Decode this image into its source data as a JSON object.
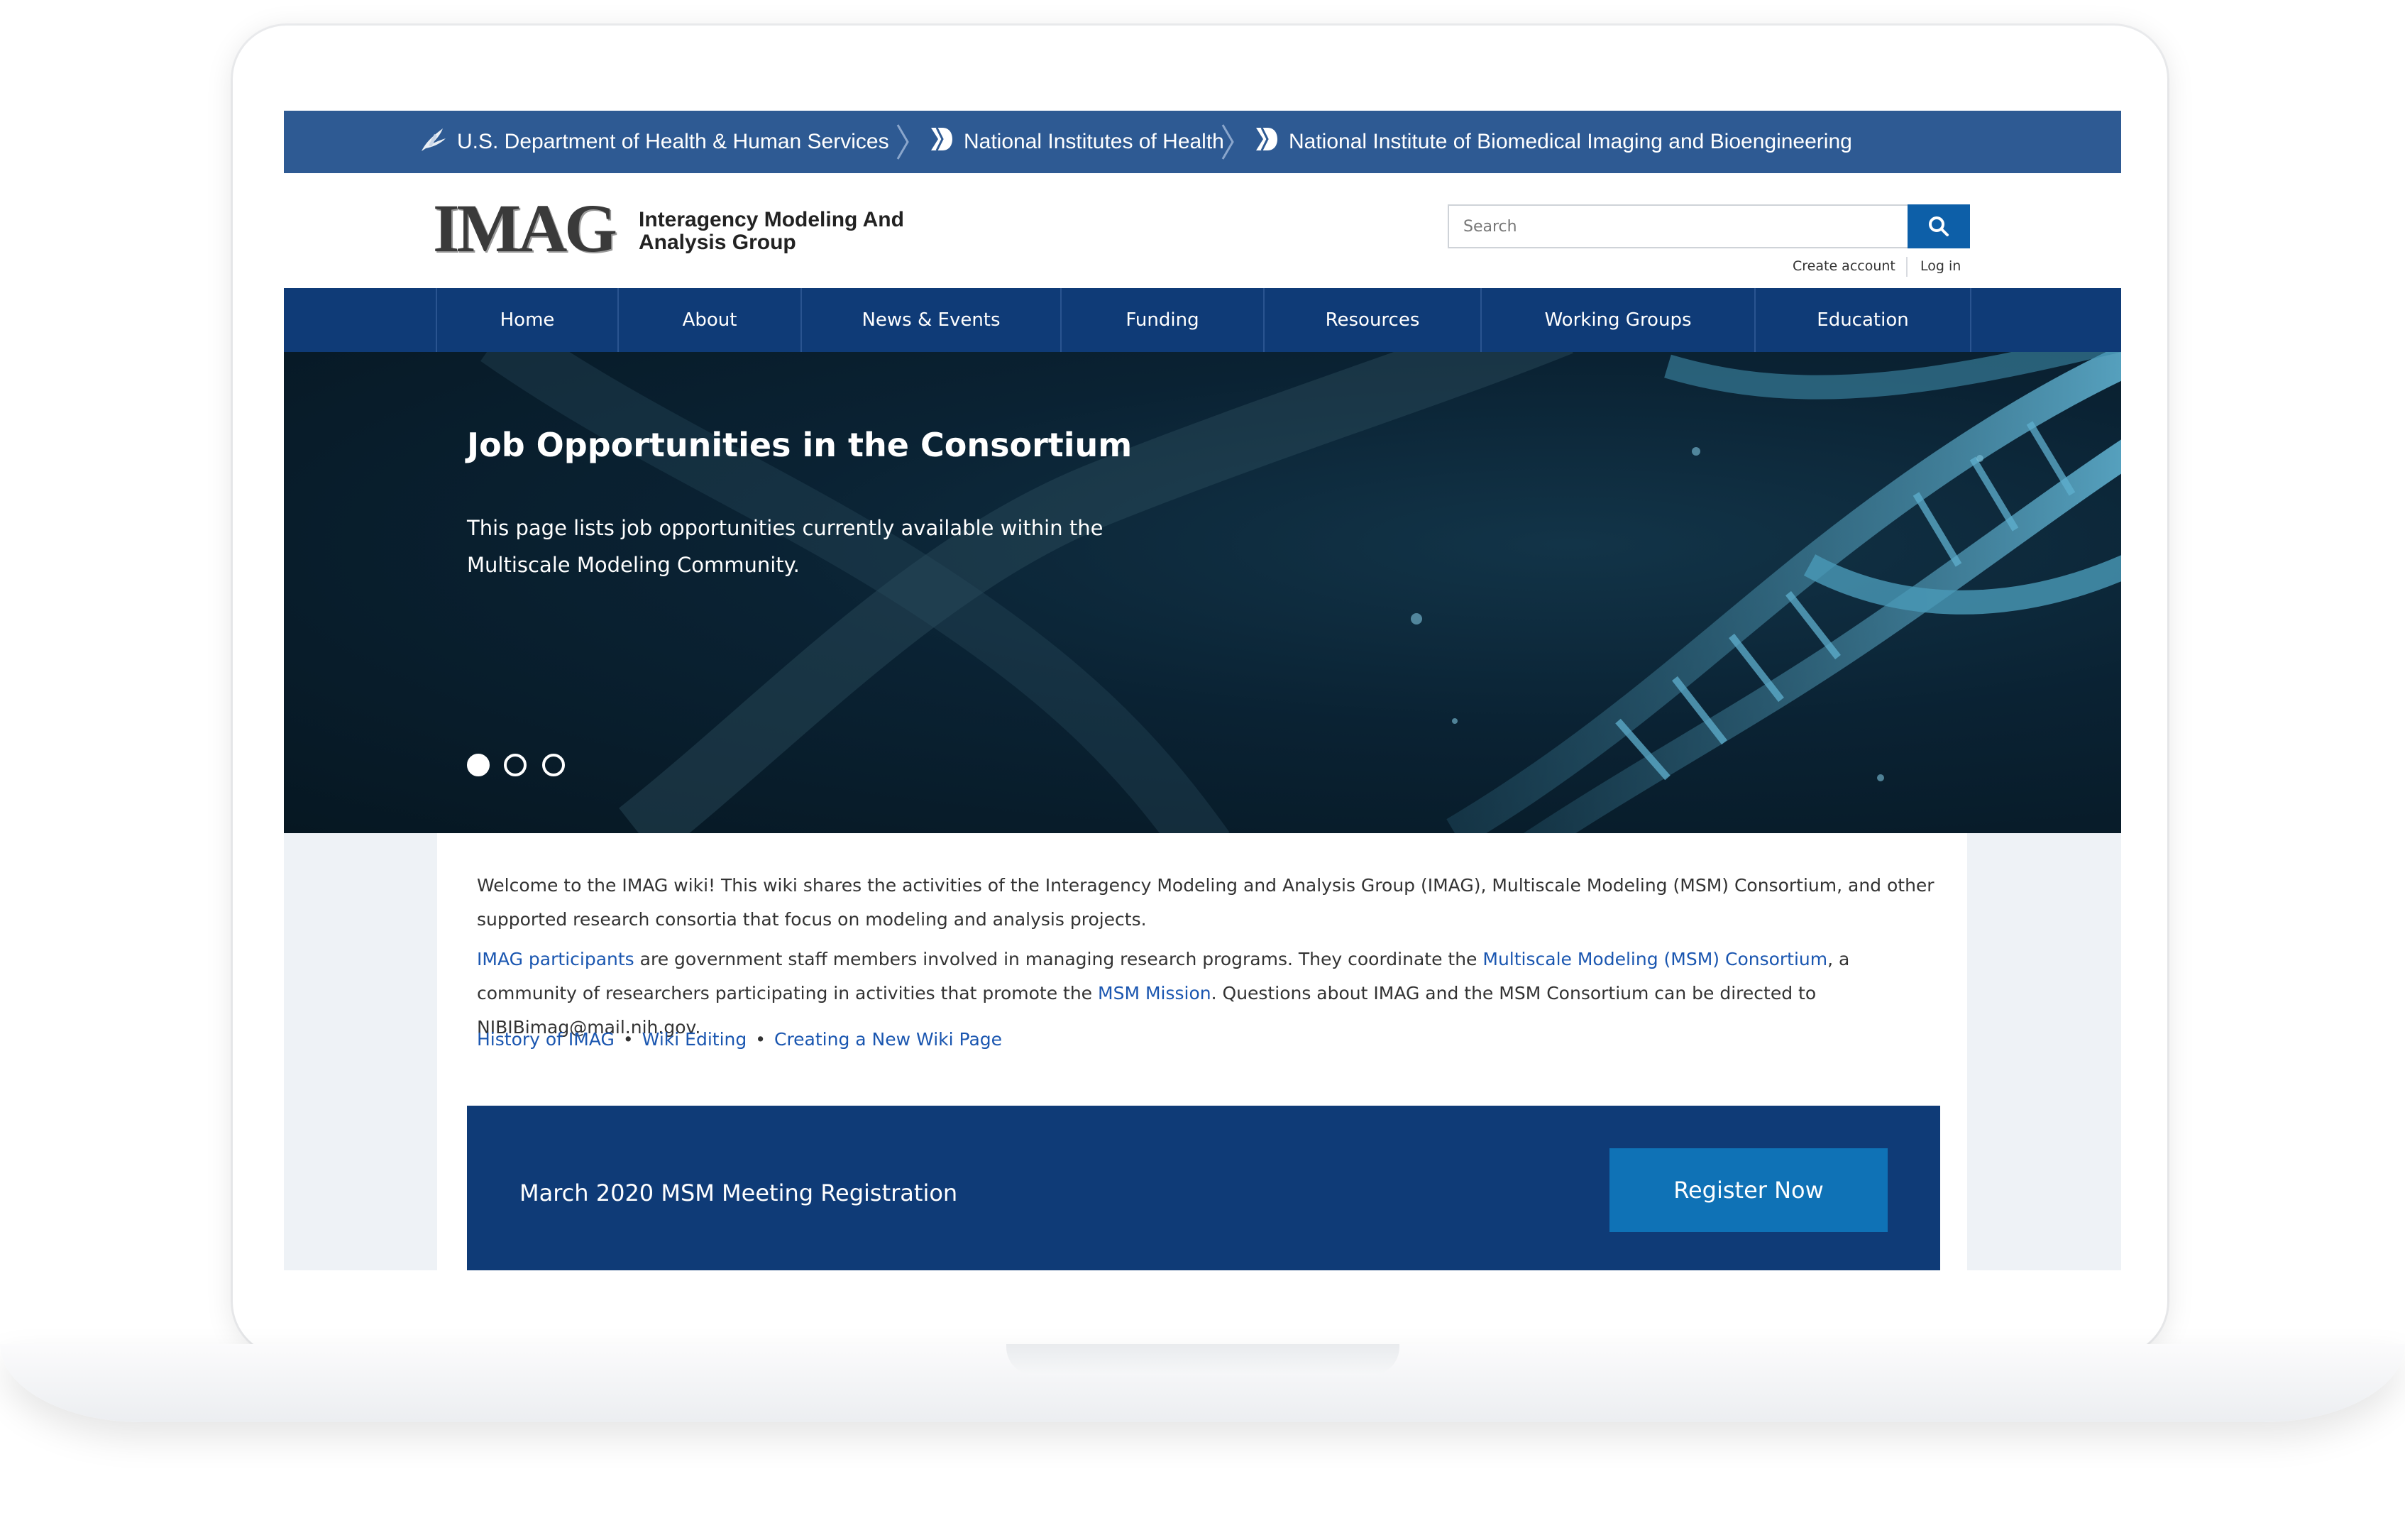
{
  "gov_bar": {
    "hhs": "U.S. Department of Health & Human Services",
    "nih": "National Institutes of Health",
    "nibib": "National Institute of Biomedical Imaging and Bioengineering"
  },
  "header": {
    "logo_mark": "IMAG",
    "logo_line1": "Interagency Modeling And",
    "logo_line2": "Analysis Group",
    "search_placeholder": "Search",
    "create_account": "Create account",
    "log_in": "Log in"
  },
  "nav": {
    "items": [
      {
        "label": "Home"
      },
      {
        "label": "About"
      },
      {
        "label": "News & Events"
      },
      {
        "label": "Funding"
      },
      {
        "label": "Resources"
      },
      {
        "label": "Working Groups"
      },
      {
        "label": "Education"
      }
    ]
  },
  "hero": {
    "title": "Job Opportunities in the Consortium",
    "description": "This page lists job opportunities currently available within the Multiscale Modeling Community.",
    "slides_total": 3,
    "active_slide": 1
  },
  "content": {
    "welcome": "Welcome to the IMAG wiki! This wiki shares the activities of the Interagency Modeling and Analysis Group (IMAG), Multiscale Modeling (MSM) Consortium, and other supported research consortia that focus on modeling and analysis projects.",
    "p2_link1": "IMAG participants",
    "p2_text1": " are government staff members involved in managing research programs. They coordinate the ",
    "p2_link2": "Multiscale Modeling (MSM) Consortium",
    "p2_text2": ", a community of researchers participating in activities that promote the ",
    "p2_link3": "MSM Mission",
    "p2_text3": ". Questions about IMAG and the MSM Consortium can be directed to NIBIBimag@mail.nih.gov.",
    "links": [
      "History of IMAG",
      "Wiki Editing",
      "Creating a New Wiki Page"
    ],
    "bullet": "•"
  },
  "registration": {
    "title": "March 2020 MSM Meeting Registration",
    "button": "Register Now"
  },
  "colors": {
    "gov_bar": "#2e5a93",
    "nav": "#0f3b77",
    "accent_button": "#0f72b6",
    "search_button": "#0d5fa8",
    "link": "#1a56b0"
  }
}
